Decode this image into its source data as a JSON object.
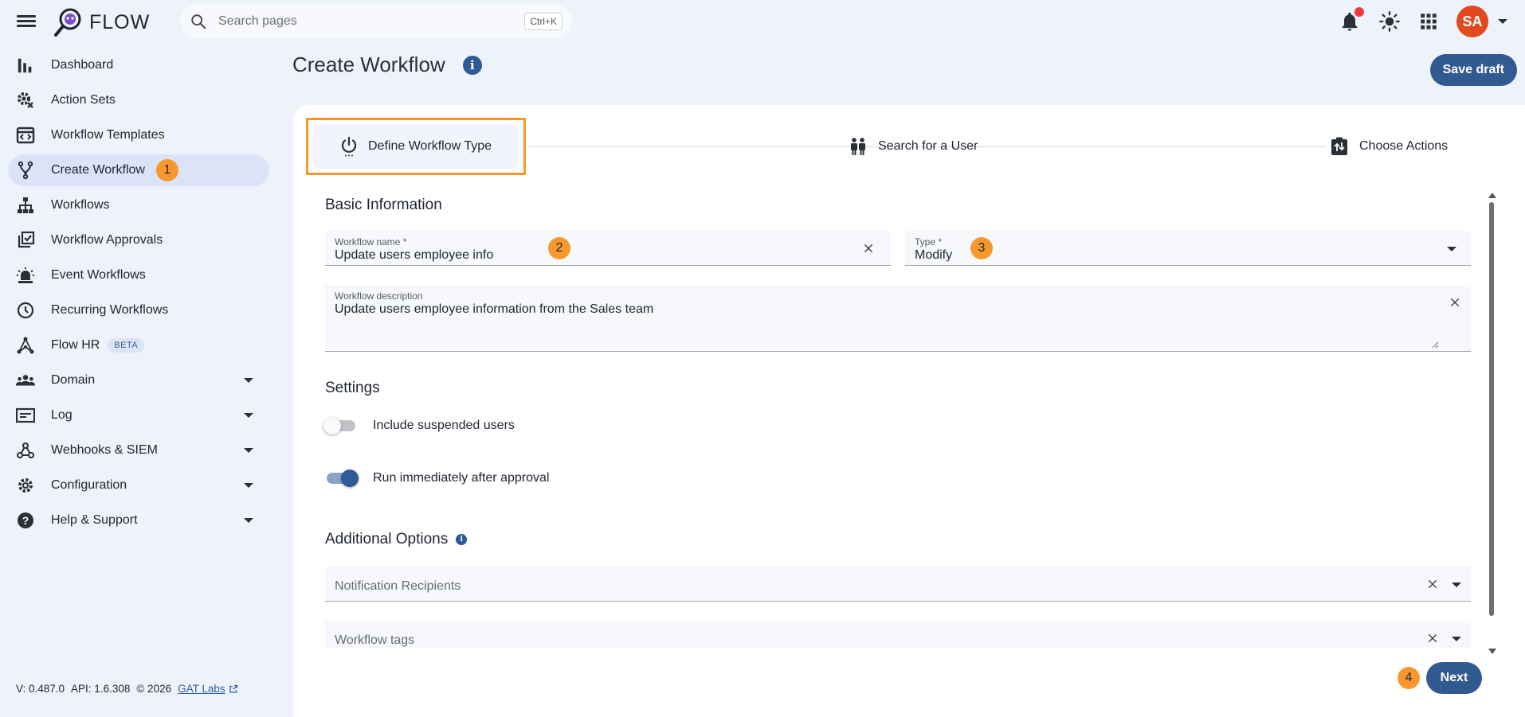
{
  "app": {
    "logo_text": "FLOW"
  },
  "search": {
    "placeholder": "Search pages",
    "shortcut": "Ctrl+K"
  },
  "user": {
    "initials": "SA"
  },
  "sidebar": {
    "items": [
      {
        "label": "Dashboard",
        "icon": "bar-chart-icon"
      },
      {
        "label": "Action Sets",
        "icon": "gear-cog-icon"
      },
      {
        "label": "Workflow Templates",
        "icon": "template-icon"
      },
      {
        "label": "Create Workflow",
        "icon": "branch-icon",
        "active": true,
        "badge": "1"
      },
      {
        "label": "Workflows",
        "icon": "sitemap-icon"
      },
      {
        "label": "Workflow Approvals",
        "icon": "checklist-icon"
      },
      {
        "label": "Event Workflows",
        "icon": "alarm-light-icon"
      },
      {
        "label": "Recurring Workflows",
        "icon": "clock-icon"
      },
      {
        "label": "Flow HR",
        "icon": "hr-network-icon",
        "tag": "BETA"
      },
      {
        "label": "Domain",
        "icon": "people-icon",
        "expandable": true
      },
      {
        "label": "Log",
        "icon": "log-icon",
        "expandable": true
      },
      {
        "label": "Webhooks & SIEM",
        "icon": "webhook-icon",
        "expandable": true
      },
      {
        "label": "Configuration",
        "icon": "settings-icon",
        "expandable": true
      },
      {
        "label": "Help & Support",
        "icon": "help-icon",
        "expandable": true
      }
    ],
    "footer": {
      "version": "V: 0.487.0",
      "api": "API: 1.6.308",
      "copyright": "© 2026",
      "link": "GAT Labs"
    }
  },
  "main": {
    "title": "Create Workflow",
    "save_draft": "Save draft",
    "steps": [
      {
        "label": "Define Workflow Type",
        "icon": "power-icon",
        "active": true
      },
      {
        "label": "Search for a User",
        "icon": "users-icon"
      },
      {
        "label": "Choose Actions",
        "icon": "swap-actions-icon"
      }
    ],
    "basic_info": {
      "heading": "Basic Information",
      "name_label": "Workflow name *",
      "name_value": "Update users employee info",
      "name_badge": "2",
      "type_label": "Type *",
      "type_value": "Modify",
      "type_badge": "3",
      "desc_label": "Workflow description",
      "desc_value": "Update users employee information from the Sales team"
    },
    "settings": {
      "heading": "Settings",
      "toggles": [
        {
          "label": "Include suspended users",
          "on": false
        },
        {
          "label": "Run immediately after approval",
          "on": true
        }
      ]
    },
    "additional": {
      "heading": "Additional Options",
      "recipients_placeholder": "Notification Recipients",
      "tags_placeholder": "Workflow tags"
    },
    "next_badge": "4",
    "next_label": "Next"
  },
  "colors": {
    "accent": "#315a90",
    "highlight": "#f7982f",
    "avatar": "#e2491f",
    "alert": "#ef3b3b"
  }
}
